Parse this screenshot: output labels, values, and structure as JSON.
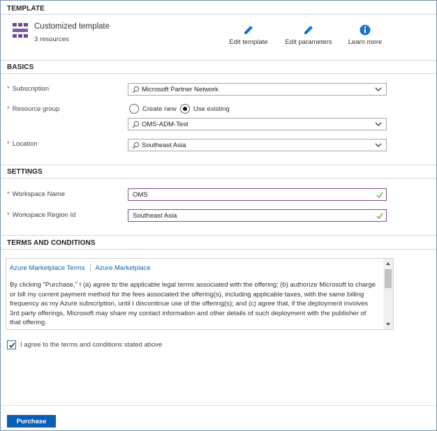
{
  "template": {
    "section_title": "TEMPLATE",
    "name": "Customized template",
    "resource_count": "3 resources",
    "actions": {
      "edit_template": "Edit template",
      "edit_parameters": "Edit parameters",
      "learn_more": "Learn more"
    },
    "icons": [
      "template-grid-icon",
      "pencil-icon",
      "pencil-icon",
      "info-icon"
    ]
  },
  "basics": {
    "section_title": "BASICS",
    "subscription": {
      "label": "Subscription",
      "value": "Microsoft Partner Network"
    },
    "resource_group": {
      "label": "Resource group",
      "options": [
        "Create new",
        "Use existing"
      ],
      "selected_option": "Use existing",
      "value": "OMS-ADM-Test"
    },
    "location": {
      "label": "Location",
      "value": "Southeast Asia"
    }
  },
  "settings": {
    "section_title": "SETTINGS",
    "workspace_name": {
      "label": "Workspace Name",
      "value": "OMS"
    },
    "workspace_region": {
      "label": "Workspace Region Id",
      "value": "Southeast Asia"
    }
  },
  "terms": {
    "section_title": "TERMS AND CONDITIONS",
    "links": [
      "Azure Marketplace Terms",
      "Azure Marketplace"
    ],
    "body": "By clicking \"Purchase,\" I (a) agree to the applicable legal terms associated with the offering; (b) authorize Microsoft to charge or bill my current payment method for the fees associated the offering(s), including applicable taxes, with the same billing frequency as my Azure subscription, until I discontinue use of the offering(s); and (c) agree that, if the deployment involves 3rd party offerings, Microsoft may share my contact information and other details of such deployment with the publisher of that offering.",
    "agree_label": "I agree to the terms and conditions stated above",
    "agree_checked": true
  },
  "footer": {
    "purchase_label": "Purchase"
  },
  "colors": {
    "accent_blue": "#0a5fb4",
    "link_blue": "#0a62b3",
    "required_red": "#c0392b",
    "valid_green": "#5ea03c",
    "template_purple": "#6b4a8c"
  }
}
